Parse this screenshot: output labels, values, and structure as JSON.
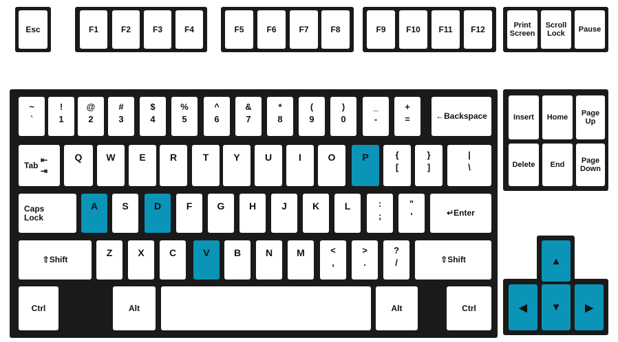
{
  "keys": {
    "esc": "Esc",
    "f1": "F1",
    "f2": "F2",
    "f3": "F3",
    "f4": "F4",
    "f5": "F5",
    "f6": "F6",
    "f7": "F7",
    "f8": "F8",
    "f9": "F9",
    "f10": "F10",
    "f11": "F11",
    "f12": "F12",
    "print_screen": "Print\nScreen",
    "scroll_lock": "Scroll\nLock",
    "pause": "Pause",
    "backquote": {
      "top": "~",
      "bottom": "`"
    },
    "d1": {
      "top": "!",
      "bottom": "1"
    },
    "d2": {
      "top": "@",
      "bottom": "2"
    },
    "d3": {
      "top": "#",
      "bottom": "3"
    },
    "d4": {
      "top": "$",
      "bottom": "4"
    },
    "d5": {
      "top": "%",
      "bottom": "5"
    },
    "d6": {
      "top": "^",
      "bottom": "6"
    },
    "d7": {
      "top": "&",
      "bottom": "7"
    },
    "d8": {
      "top": "*",
      "bottom": "8"
    },
    "d9": {
      "top": "(",
      "bottom": "9"
    },
    "d0": {
      "top": ")",
      "bottom": "0"
    },
    "minus": {
      "top": "_",
      "bottom": "-"
    },
    "equal": {
      "top": "+",
      "bottom": "="
    },
    "backspace": "←Backspace",
    "tab": "Tab",
    "q": "Q",
    "w": "W",
    "e": "E",
    "r": "R",
    "t": "T",
    "y": "Y",
    "u": "U",
    "i": "I",
    "o": "O",
    "p": "P",
    "lbracket": {
      "top": "{",
      "bottom": "["
    },
    "rbracket": {
      "top": "}",
      "bottom": "]"
    },
    "backslash": {
      "top": "|",
      "bottom": "\\"
    },
    "caps_lock": "Caps\nLock",
    "a": "A",
    "s": "S",
    "d": "D",
    "f": "F",
    "g": "G",
    "h": "H",
    "j": "J",
    "k": "K",
    "l": "L",
    "semicolon": {
      "top": ":",
      "bottom": ";"
    },
    "quote": {
      "top": "\"",
      "bottom": "'"
    },
    "enter": "↵Enter",
    "lshift": "⇧Shift",
    "z": "Z",
    "x": "X",
    "c": "C",
    "v": "V",
    "b": "B",
    "n": "N",
    "m": "M",
    "comma": {
      "top": "<",
      "bottom": ","
    },
    "period": {
      "top": ">",
      "bottom": "."
    },
    "slash": {
      "top": "?",
      "bottom": "/"
    },
    "rshift": "⇧Shift",
    "lctrl": "Ctrl",
    "lalt": "Alt",
    "ralt": "Alt",
    "rctrl": "Ctrl",
    "insert": "Insert",
    "home": "Home",
    "page_up": "Page\nUp",
    "delete": "Delete",
    "end": "End",
    "page_down": "Page\nDown"
  },
  "highlighted_keys": [
    "P",
    "A",
    "D",
    "V",
    "Up",
    "Left",
    "Down",
    "Right"
  ],
  "highlight_color": "#0a94b8",
  "arrow_icons": {
    "up": "arrow-up-icon",
    "left": "arrow-left-icon",
    "down": "arrow-down-icon",
    "right": "arrow-right-icon"
  }
}
